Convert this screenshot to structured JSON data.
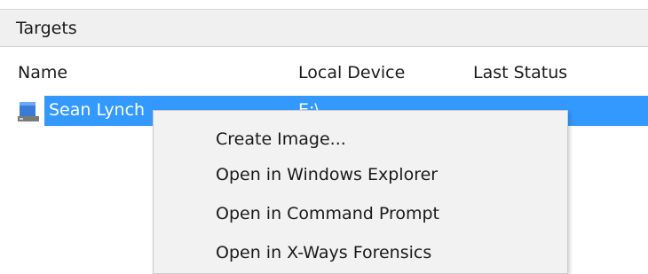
{
  "panel": {
    "title": "Targets"
  },
  "table": {
    "columns": [
      "Name",
      "Local Device",
      "Last Status"
    ],
    "rows": [
      {
        "name": "Sean Lynch",
        "local_device": "E:\\",
        "last_status": "",
        "icon": "drive-icon",
        "selected": true
      }
    ]
  },
  "context_menu": {
    "items": [
      "Create Image...",
      "Open in Windows Explorer",
      "Open in Command Prompt",
      "Open in X-Ways Forensics"
    ]
  },
  "colors": {
    "selection": "#3399ff",
    "header_bg": "#f0f0f0",
    "menu_bg": "#f2f2f2"
  }
}
